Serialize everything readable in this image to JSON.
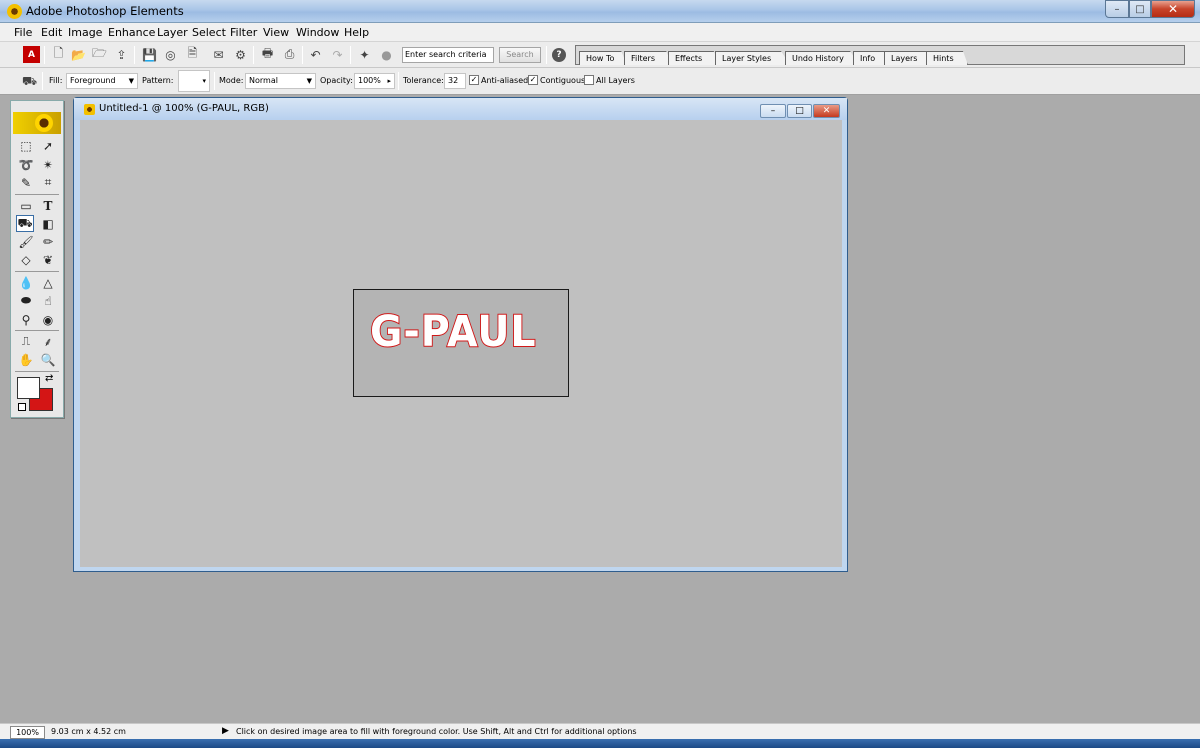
{
  "app": {
    "title": "Adobe Photoshop Elements",
    "win_min": "–",
    "win_max": "□",
    "win_close": "✕"
  },
  "menu": [
    "File",
    "Edit",
    "Image",
    "Enhance",
    "Layer",
    "Select",
    "Filter",
    "View",
    "Window",
    "Help"
  ],
  "shortcuts": {
    "search_placeholder": "Enter search criteria",
    "search_button": "Search",
    "help_icon": "?"
  },
  "palette_well": {
    "tabs": [
      "How To",
      "Filters",
      "Effects",
      "Layer Styles",
      "Undo History",
      "Info",
      "Layers",
      "Hints"
    ]
  },
  "options_bar": {
    "fill_label": "Fill:",
    "fill_value": "Foreground",
    "pattern_label": "Pattern:",
    "mode_label": "Mode:",
    "mode_value": "Normal",
    "opacity_label": "Opacity:",
    "opacity_value": "100%",
    "tolerance_label": "Tolerance:",
    "tolerance_value": "32",
    "anti_aliased_label": "Anti-aliased",
    "anti_aliased_checked": true,
    "contiguous_label": "Contiguous",
    "contiguous_checked": true,
    "all_layers_label": "All Layers",
    "all_layers_checked": false
  },
  "toolbox": {
    "foreground_color": "#ffffff",
    "background_color": "#d41515",
    "active_tool": "paint-bucket"
  },
  "document": {
    "title": "Untitled-1 @ 100% (G-PAUL, RGB)",
    "image_text": "G-PAUL",
    "text_fill": "#ffffff",
    "text_stroke": "#d01818"
  },
  "status": {
    "zoom": "100%",
    "doc_size": "9.03 cm x 4.52 cm",
    "message": "Click on desired image area to fill with foreground color.  Use Shift, Alt and Ctrl for additional options"
  }
}
